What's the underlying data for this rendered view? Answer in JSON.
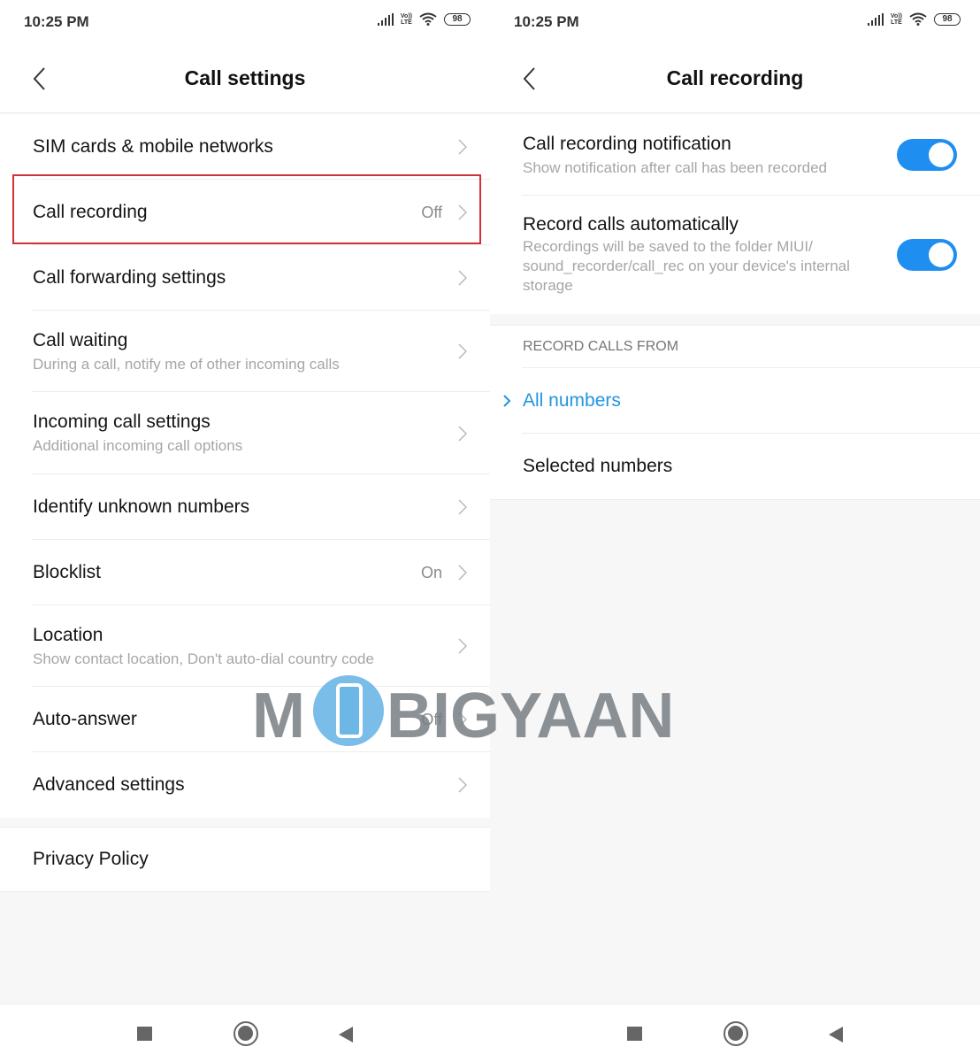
{
  "left": {
    "status": {
      "time": "10:25 PM",
      "volte_top": "Vo))",
      "volte_bottom": "LTE",
      "battery": "98"
    },
    "title": "Call settings",
    "items": [
      {
        "title": "SIM cards & mobile networks",
        "subtitle": "",
        "value": ""
      },
      {
        "title": "Call recording",
        "subtitle": "",
        "value": "Off"
      },
      {
        "title": "Call forwarding settings",
        "subtitle": "",
        "value": ""
      },
      {
        "title": "Call waiting",
        "subtitle": "During a call, notify me of other incoming calls",
        "value": ""
      },
      {
        "title": "Incoming call settings",
        "subtitle": "Additional incoming call options",
        "value": ""
      },
      {
        "title": "Identify unknown numbers",
        "subtitle": "",
        "value": ""
      },
      {
        "title": "Blocklist",
        "subtitle": "",
        "value": "On"
      },
      {
        "title": "Location",
        "subtitle": "Show contact location, Don't auto-dial country code",
        "value": ""
      },
      {
        "title": "Auto-answer",
        "subtitle": "",
        "value": "Off"
      },
      {
        "title": "Advanced settings",
        "subtitle": "",
        "value": ""
      }
    ],
    "privacy": "Privacy Policy"
  },
  "right": {
    "status": {
      "time": "10:25 PM",
      "volte_top": "Vo))",
      "volte_bottom": "LTE",
      "battery": "98"
    },
    "title": "Call recording",
    "toggles": [
      {
        "title": "Call recording notification",
        "subtitle": "Show notification after call has been recorded",
        "on": true
      },
      {
        "title": "Record calls automatically",
        "subtitle": "Recordings will be saved to the folder MIUI/ sound_recorder/call_rec on your device's internal storage",
        "on": true
      }
    ],
    "section_header": "RECORD CALLS FROM",
    "options": [
      {
        "label": "All numbers",
        "selected": true
      },
      {
        "label": "Selected numbers",
        "selected": false
      }
    ]
  },
  "watermark": {
    "pre": "M",
    "post": "BIGYAAN"
  },
  "colors": {
    "accent": "#1e8ff0",
    "selected_text": "#2196e0",
    "highlight": "#d3303a"
  }
}
